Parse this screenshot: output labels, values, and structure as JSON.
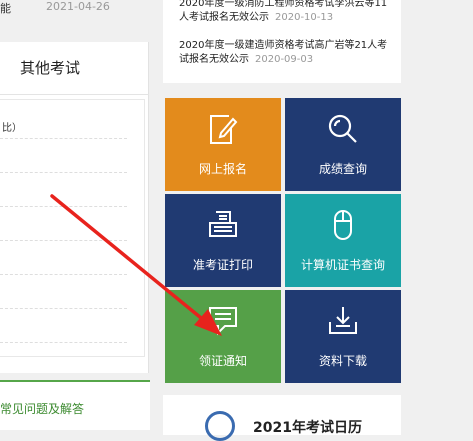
{
  "left": {
    "top_text": "能",
    "top_date": "2021-04-26",
    "tab_label": "其他考试",
    "list_text": "比）",
    "faq_label": "常见问题及解答"
  },
  "news": {
    "items": [
      {
        "title": "2020年度一级消防工程师资格考试李洪云等11人考试报名无效公示",
        "date": "2020-10-13"
      },
      {
        "title": "2020年度一级建造师资格考试高广岩等21人考试报名无效公示",
        "date": "2020-09-03"
      }
    ]
  },
  "tiles": [
    {
      "label": "网上报名",
      "icon": "edit-icon",
      "color": "#e38b1c"
    },
    {
      "label": "成绩查询",
      "icon": "search-icon",
      "color": "#203a72"
    },
    {
      "label": "准考证打印",
      "icon": "printer-icon",
      "color": "#203a72"
    },
    {
      "label": "计算机证书查询",
      "icon": "mouse-icon",
      "color": "#1aa3a6"
    },
    {
      "label": "领证通知",
      "icon": "message-icon",
      "color": "#55a048"
    },
    {
      "label": "资料下载",
      "icon": "download-icon",
      "color": "#203a72"
    }
  ],
  "bottom": {
    "title": "2021年考试日历",
    "icon": "clock-icon"
  },
  "annotation": {
    "arrow_color": "#e8231d"
  }
}
